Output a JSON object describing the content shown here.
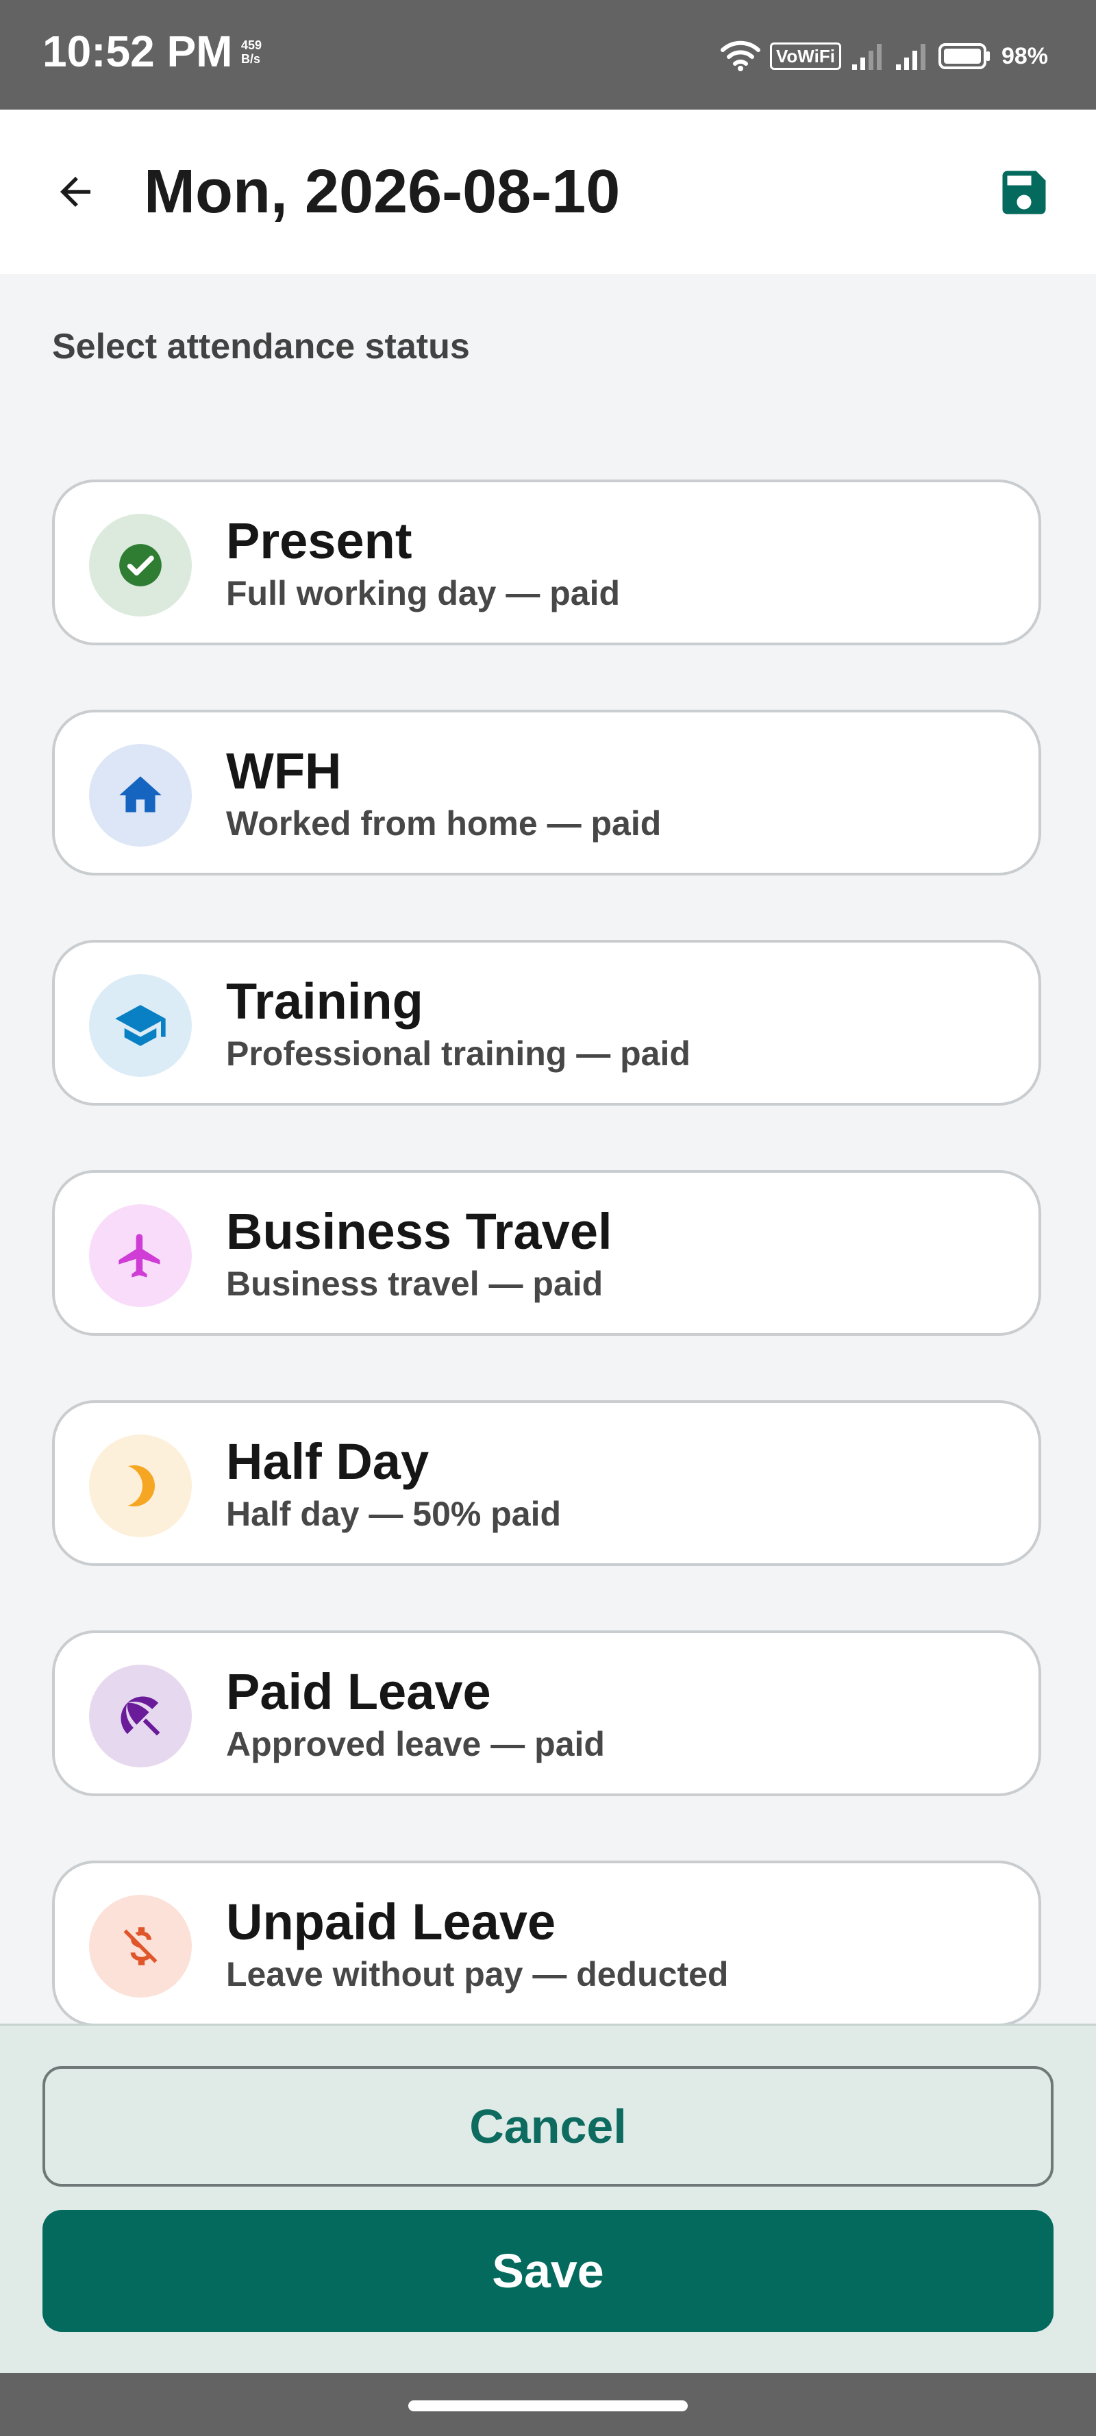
{
  "status_bar": {
    "time": "10:52 PM",
    "speed_value": "459",
    "speed_unit": "B/s",
    "vowifi": "VoWiFi",
    "battery": "98%"
  },
  "app_bar": {
    "title": "Mon, 2026-08-10",
    "back_icon": "arrow-left-icon",
    "save_icon": "floppy-disk-icon"
  },
  "subtitle": "Select attendance status",
  "options": [
    {
      "title": "Present",
      "subtitle": "Full working day — paid",
      "icon": "check-circle-icon",
      "bg": "#dbeadc",
      "color": "#2e7d32"
    },
    {
      "title": "WFH",
      "subtitle": "Worked from home — paid",
      "icon": "home-icon",
      "bg": "#dde6f6",
      "color": "#1565c0"
    },
    {
      "title": "Training",
      "subtitle": "Professional training — paid",
      "icon": "graduation-cap-icon",
      "bg": "#dbecf7",
      "color": "#0a80c4"
    },
    {
      "title": "Business Travel",
      "subtitle": "Business travel — paid",
      "icon": "airplane-icon",
      "bg": "#f8dcf9",
      "color": "#cf3dd6"
    },
    {
      "title": "Half Day",
      "subtitle": "Half day — 50% paid",
      "icon": "half-moon-icon",
      "bg": "#fdf0da",
      "color": "#f5a623"
    },
    {
      "title": "Paid Leave",
      "subtitle": "Approved leave — paid",
      "icon": "beach-umbrella-icon",
      "bg": "#e6d8ee",
      "color": "#6a1b9a"
    },
    {
      "title": "Unpaid Leave",
      "subtitle": "Leave without pay — deducted",
      "icon": "money-off-icon",
      "bg": "#fbe1d7",
      "color": "#e0562b"
    }
  ],
  "buttons": {
    "cancel": "Cancel",
    "save": "Save"
  },
  "colors": {
    "primary": "#046a5d",
    "status_bar": "#636363"
  }
}
